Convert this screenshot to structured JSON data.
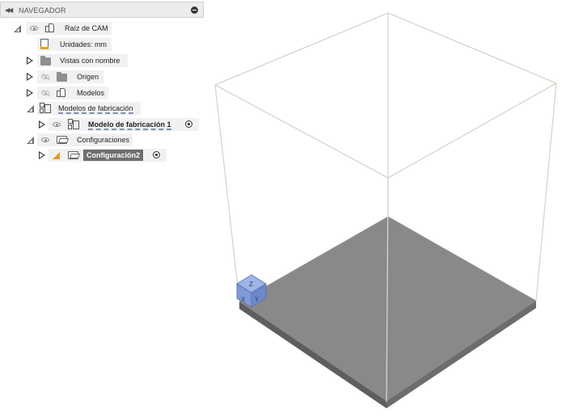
{
  "navigator": {
    "title": "NAVEGADOR",
    "items": [
      {
        "id": "root",
        "label": "Raíz de CAM",
        "expanded": true
      },
      {
        "id": "units",
        "label": "Unidades: mm"
      },
      {
        "id": "named_views",
        "label": "Vistas con nombre",
        "expanded": false
      },
      {
        "id": "origin",
        "label": "Origen",
        "expanded": false
      },
      {
        "id": "models",
        "label": "Modelos",
        "expanded": false
      },
      {
        "id": "manufacturing_models",
        "label": "Modelos de fabricación",
        "expanded": true
      },
      {
        "id": "manufacturing_model_1",
        "label": "Modelo de fabricación 1",
        "expanded": false
      },
      {
        "id": "setups",
        "label": "Configuraciones",
        "expanded": true
      },
      {
        "id": "setup_2",
        "label": "Configuración2",
        "expanded": false,
        "selected": true
      }
    ]
  },
  "viewcube": {
    "labels": [
      "Z",
      "X",
      "Y"
    ]
  },
  "colors": {
    "accent_selected": "#6e6e6e",
    "build_plate": "#898989",
    "warning": "#e8961f",
    "viewcube": "#7f9ad6"
  }
}
